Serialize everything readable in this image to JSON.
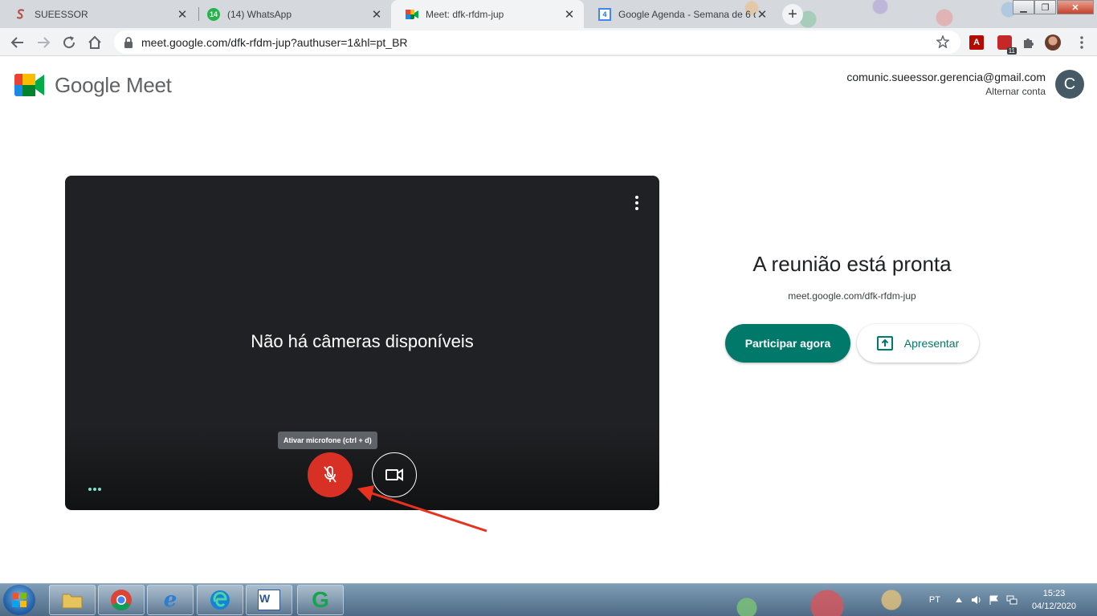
{
  "browser": {
    "tabs": [
      {
        "title": "SUEESSOR",
        "active": false
      },
      {
        "title": "(14) WhatsApp",
        "badge": "14",
        "active": false
      },
      {
        "title": "Meet: dfk-rfdm-jup",
        "active": true
      },
      {
        "title": "Google Agenda - Semana de 6 d",
        "badge": "4",
        "active": false
      }
    ],
    "new_tab_label": "+",
    "url": "meet.google.com/dfk-rfdm-jup?authuser=1&hl=pt_BR",
    "extension_badge": "11"
  },
  "meet": {
    "brand_name": "Google Meet",
    "account_email": "comunic.sueessor.gerencia@gmail.com",
    "switch_account": "Alternar conta",
    "avatar_letter": "C",
    "no_camera_text": "Não há câmeras disponíveis",
    "mic_tooltip": "Ativar microfone (ctrl + d)",
    "mic_state": "off",
    "ready_title": "A reunião está pronta",
    "meeting_link": "meet.google.com/dfk-rfdm-jup",
    "join_label": "Participar agora",
    "present_label": "Apresentar"
  },
  "annotation": {
    "arrow_color": "#e8321f",
    "points_to": "mic-button"
  },
  "colors": {
    "accent": "#00796b",
    "mic_off": "#d93025",
    "preview_bg": "#202124"
  },
  "taskbar": {
    "apps": [
      "windows-explorer",
      "google-chrome",
      "internet-explorer",
      "microsoft-edge",
      "microsoft-word",
      "grammarly"
    ],
    "language": "PT",
    "time": "15:23",
    "date": "04/12/2020"
  }
}
